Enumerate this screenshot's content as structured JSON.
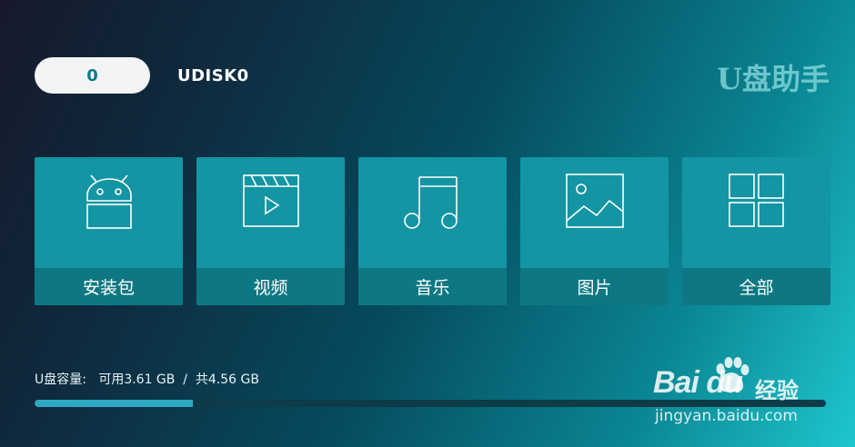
{
  "header": {
    "count": "0",
    "device_name": "UDISK0",
    "app_title": "U盘助手"
  },
  "tiles": [
    {
      "label": "安装包",
      "icon": "android-icon"
    },
    {
      "label": "视频",
      "icon": "video-icon"
    },
    {
      "label": "音乐",
      "icon": "music-icon"
    },
    {
      "label": "图片",
      "icon": "image-icon"
    },
    {
      "label": "全部",
      "icon": "grid-icon"
    }
  ],
  "storage": {
    "text": "U盘容量:   可用3.61 GB  /  共4.56 GB",
    "available_gb": 3.61,
    "total_gb": 4.56,
    "used_fraction": 0.2
  },
  "watermark": {
    "logo_text": "Bai  du",
    "cn_text": "经验",
    "url": "jingyan.baidu.com"
  },
  "colors": {
    "tile": "#1395a3",
    "tile_label": "#0d7883",
    "bar_fill": "#2fa9c2",
    "bar_track": "#0d3b48",
    "pill_text": "#0b7a8c"
  }
}
